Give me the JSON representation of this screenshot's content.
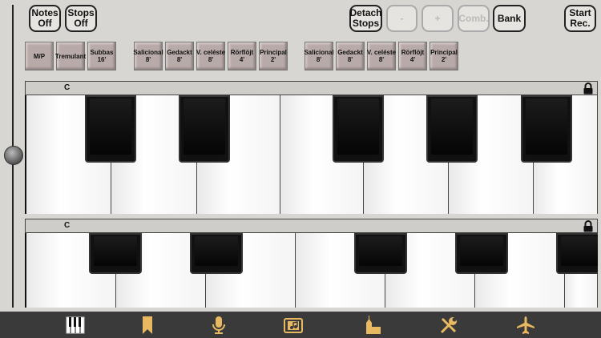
{
  "top_buttons": {
    "notes_off": "Notes\nOff",
    "stops_off": "Stops\nOff",
    "detach_stops": "Detach\nStops",
    "minus": "-",
    "plus": "+",
    "comb": "Comb.",
    "bank": "Bank",
    "start_rec": "Start\nRec."
  },
  "stops_group1": [
    "M/P",
    "Tremulant",
    "Subbas\n16'"
  ],
  "stops_group2": [
    "Salicional\n8'",
    "Gedackt\n8'",
    "V. celéste\n8'",
    "Rörflöjt\n4'",
    "Principal\n2'"
  ],
  "stops_group3": [
    "Salicional\n8'",
    "Gedackt\n8'",
    "V. celéste\n8'",
    "Rörflöjt\n4'",
    "Principal\n2'"
  ],
  "manual_upper": {
    "label": "C"
  },
  "manual_lower": {
    "label": "C"
  },
  "tabbar": {
    "icons": [
      "keyboard-icon",
      "bookmark-icon",
      "microphone-icon",
      "music-folder-icon",
      "church-icon",
      "tools-icon",
      "airplane-icon"
    ],
    "accent_color": "#e8b960"
  }
}
